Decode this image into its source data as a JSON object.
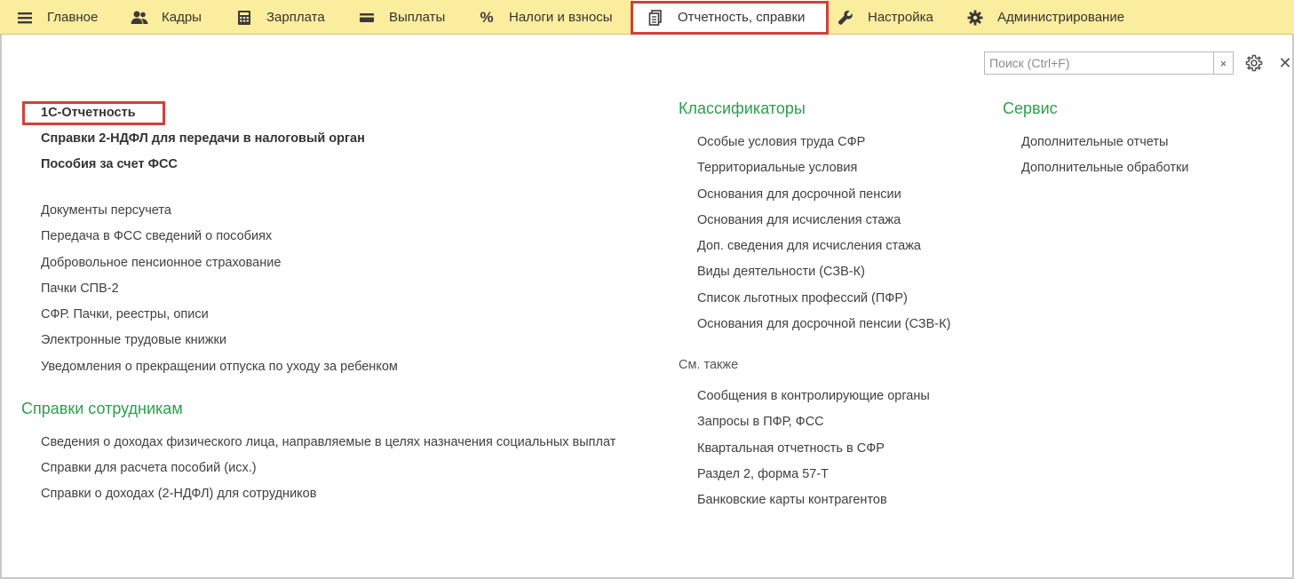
{
  "menu": {
    "items": [
      {
        "label": "Главное",
        "icon": "hamburger-icon"
      },
      {
        "label": "Кадры",
        "icon": "people-icon"
      },
      {
        "label": "Зарплата",
        "icon": "calculator-icon"
      },
      {
        "label": "Выплаты",
        "icon": "wallet-icon"
      },
      {
        "label": "Налоги и взносы",
        "icon": "percent-icon"
      },
      {
        "label": "Отчетность, справки",
        "icon": "documents-icon"
      },
      {
        "label": "Настройка",
        "icon": "wrench-icon"
      },
      {
        "label": "Администрирование",
        "icon": "gear-icon"
      }
    ],
    "active_index": 5,
    "highlight_color": "#d0413b",
    "bar_color": "#fbed9e"
  },
  "search": {
    "placeholder": "Поиск (Ctrl+F)",
    "value": "",
    "clear_glyph": "×"
  },
  "close_glyph": "✕",
  "left": {
    "bold_links": [
      "1С-Отчетность",
      "Справки 2-НДФЛ для передачи в налоговый орган",
      "Пособия за счет ФСС"
    ],
    "links": [
      "Документы персучета",
      "Передача в ФСС сведений о пособиях",
      "Добровольное пенсионное страхование",
      "Пачки СПВ-2",
      "СФР. Пачки, реестры, описи",
      "Электронные трудовые книжки",
      "Уведомления о прекращении отпуска по уходу за ребенком"
    ],
    "employees_section": {
      "title": "Справки сотрудникам",
      "links": [
        "Сведения о доходах физического лица, направляемые в целях назначения социальных выплат",
        "Справки для расчета пособий (исх.)",
        "Справки о доходах (2-НДФЛ) для сотрудников"
      ]
    }
  },
  "middle": {
    "classifiers": {
      "title": "Классификаторы",
      "links": [
        "Особые условия труда СФР",
        "Территориальные условия",
        "Основания для досрочной пенсии",
        "Основания для исчисления стажа",
        "Доп. сведения для исчисления стажа",
        "Виды деятельности (СЗВ-К)",
        "Список льготных профессий (ПФР)",
        "Основания для досрочной пенсии (СЗВ-К)"
      ]
    },
    "see_also": {
      "title": "См. также",
      "links": [
        "Сообщения в контролирующие органы",
        "Запросы в ПФР, ФСС",
        "Квартальная отчетность в СФР",
        "Раздел 2, форма 57-Т",
        "Банковские карты контрагентов"
      ]
    }
  },
  "right": {
    "service": {
      "title": "Сервис",
      "links": [
        "Дополнительные отчеты",
        "Дополнительные обработки"
      ]
    }
  }
}
